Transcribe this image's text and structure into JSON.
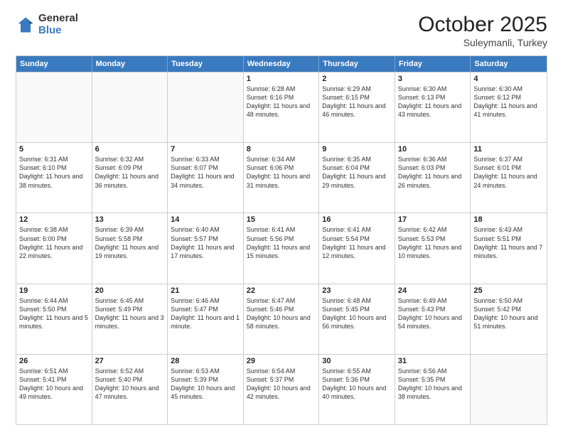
{
  "logo": {
    "general": "General",
    "blue": "Blue"
  },
  "header": {
    "month": "October 2025",
    "location": "Suleymanli, Turkey"
  },
  "weekdays": [
    "Sunday",
    "Monday",
    "Tuesday",
    "Wednesday",
    "Thursday",
    "Friday",
    "Saturday"
  ],
  "rows": [
    [
      {
        "day": "",
        "text": ""
      },
      {
        "day": "",
        "text": ""
      },
      {
        "day": "",
        "text": ""
      },
      {
        "day": "1",
        "text": "Sunrise: 6:28 AM\nSunset: 6:16 PM\nDaylight: 11 hours and 48 minutes."
      },
      {
        "day": "2",
        "text": "Sunrise: 6:29 AM\nSunset: 6:15 PM\nDaylight: 11 hours and 46 minutes."
      },
      {
        "day": "3",
        "text": "Sunrise: 6:30 AM\nSunset: 6:13 PM\nDaylight: 11 hours and 43 minutes."
      },
      {
        "day": "4",
        "text": "Sunrise: 6:30 AM\nSunset: 6:12 PM\nDaylight: 11 hours and 41 minutes."
      }
    ],
    [
      {
        "day": "5",
        "text": "Sunrise: 6:31 AM\nSunset: 6:10 PM\nDaylight: 11 hours and 38 minutes."
      },
      {
        "day": "6",
        "text": "Sunrise: 6:32 AM\nSunset: 6:09 PM\nDaylight: 11 hours and 36 minutes."
      },
      {
        "day": "7",
        "text": "Sunrise: 6:33 AM\nSunset: 6:07 PM\nDaylight: 11 hours and 34 minutes."
      },
      {
        "day": "8",
        "text": "Sunrise: 6:34 AM\nSunset: 6:06 PM\nDaylight: 11 hours and 31 minutes."
      },
      {
        "day": "9",
        "text": "Sunrise: 6:35 AM\nSunset: 6:04 PM\nDaylight: 11 hours and 29 minutes."
      },
      {
        "day": "10",
        "text": "Sunrise: 6:36 AM\nSunset: 6:03 PM\nDaylight: 11 hours and 26 minutes."
      },
      {
        "day": "11",
        "text": "Sunrise: 6:37 AM\nSunset: 6:01 PM\nDaylight: 11 hours and 24 minutes."
      }
    ],
    [
      {
        "day": "12",
        "text": "Sunrise: 6:38 AM\nSunset: 6:00 PM\nDaylight: 11 hours and 22 minutes."
      },
      {
        "day": "13",
        "text": "Sunrise: 6:39 AM\nSunset: 5:58 PM\nDaylight: 11 hours and 19 minutes."
      },
      {
        "day": "14",
        "text": "Sunrise: 6:40 AM\nSunset: 5:57 PM\nDaylight: 11 hours and 17 minutes."
      },
      {
        "day": "15",
        "text": "Sunrise: 6:41 AM\nSunset: 5:56 PM\nDaylight: 11 hours and 15 minutes."
      },
      {
        "day": "16",
        "text": "Sunrise: 6:41 AM\nSunset: 5:54 PM\nDaylight: 11 hours and 12 minutes."
      },
      {
        "day": "17",
        "text": "Sunrise: 6:42 AM\nSunset: 5:53 PM\nDaylight: 11 hours and 10 minutes."
      },
      {
        "day": "18",
        "text": "Sunrise: 6:43 AM\nSunset: 5:51 PM\nDaylight: 11 hours and 7 minutes."
      }
    ],
    [
      {
        "day": "19",
        "text": "Sunrise: 6:44 AM\nSunset: 5:50 PM\nDaylight: 11 hours and 5 minutes."
      },
      {
        "day": "20",
        "text": "Sunrise: 6:45 AM\nSunset: 5:49 PM\nDaylight: 11 hours and 3 minutes."
      },
      {
        "day": "21",
        "text": "Sunrise: 6:46 AM\nSunset: 5:47 PM\nDaylight: 11 hours and 1 minute."
      },
      {
        "day": "22",
        "text": "Sunrise: 6:47 AM\nSunset: 5:46 PM\nDaylight: 10 hours and 58 minutes."
      },
      {
        "day": "23",
        "text": "Sunrise: 6:48 AM\nSunset: 5:45 PM\nDaylight: 10 hours and 56 minutes."
      },
      {
        "day": "24",
        "text": "Sunrise: 6:49 AM\nSunset: 5:43 PM\nDaylight: 10 hours and 54 minutes."
      },
      {
        "day": "25",
        "text": "Sunrise: 6:50 AM\nSunset: 5:42 PM\nDaylight: 10 hours and 51 minutes."
      }
    ],
    [
      {
        "day": "26",
        "text": "Sunrise: 6:51 AM\nSunset: 5:41 PM\nDaylight: 10 hours and 49 minutes."
      },
      {
        "day": "27",
        "text": "Sunrise: 6:52 AM\nSunset: 5:40 PM\nDaylight: 10 hours and 47 minutes."
      },
      {
        "day": "28",
        "text": "Sunrise: 6:53 AM\nSunset: 5:39 PM\nDaylight: 10 hours and 45 minutes."
      },
      {
        "day": "29",
        "text": "Sunrise: 6:54 AM\nSunset: 5:37 PM\nDaylight: 10 hours and 42 minutes."
      },
      {
        "day": "30",
        "text": "Sunrise: 6:55 AM\nSunset: 5:36 PM\nDaylight: 10 hours and 40 minutes."
      },
      {
        "day": "31",
        "text": "Sunrise: 6:56 AM\nSunset: 5:35 PM\nDaylight: 10 hours and 38 minutes."
      },
      {
        "day": "",
        "text": ""
      }
    ]
  ]
}
